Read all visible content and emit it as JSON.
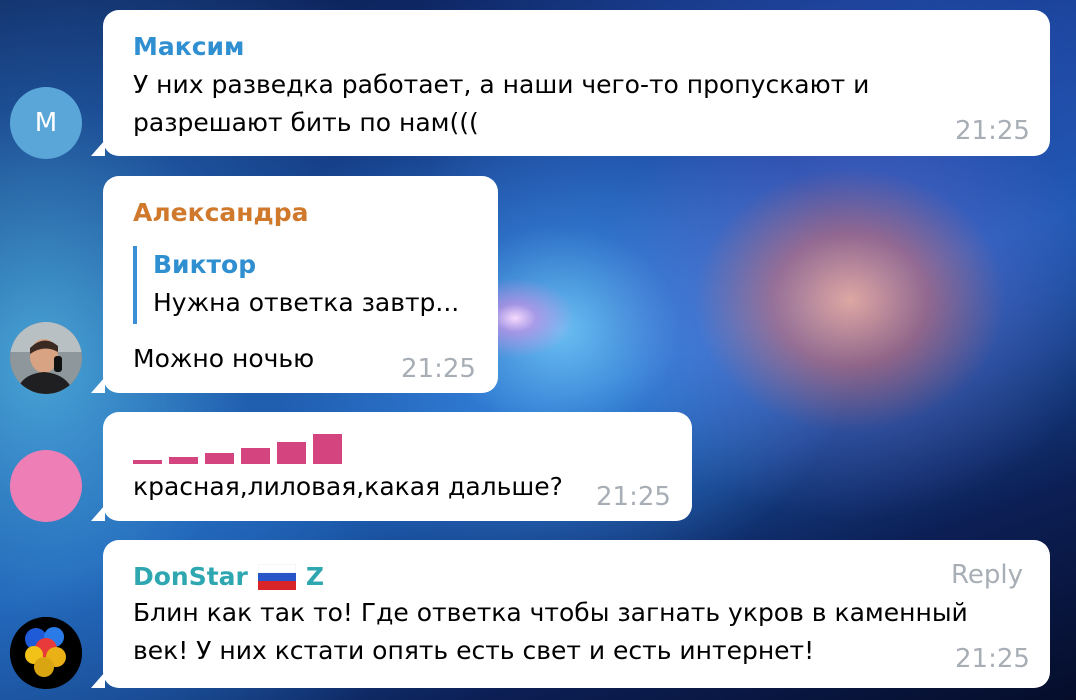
{
  "messages": [
    {
      "author": "Максим",
      "author_color": "#2f8fd0",
      "text_lines": [
        "У них разведка работает, а наши чего-то пропускают и",
        "разрешают бить по нам((("
      ],
      "time": "21:25",
      "avatar_letter": "М",
      "avatar_color": "#5aa6d9"
    },
    {
      "author": "Александра",
      "author_color": "#d0792c",
      "reply_to": {
        "author": "Виктор",
        "text": "Нужна ответка завтр..."
      },
      "text": "Можно ночью",
      "time": "21:25",
      "avatar_icon": "user-photo"
    },
    {
      "bars_color": "#d4447e",
      "bars_levels": [
        1,
        2,
        3,
        4,
        5,
        6
      ],
      "text": "красная,лиловая,какая дальше?",
      "time": "21:25",
      "avatar_color": "#ee7fb6"
    },
    {
      "author": "DonStar",
      "author_suffix": "Z",
      "author_color": "#2fa7b0",
      "flag_icon": "russian-flag-icon",
      "reply_label": "Reply",
      "text_lines": [
        "Блин как так то! Где ответка чтобы загнать укров в каменный",
        "век! У них кстати опять есть свет и есть интернет!"
      ],
      "time": "21:25",
      "avatar_icon": "colorful-smoke-avatar"
    }
  ]
}
